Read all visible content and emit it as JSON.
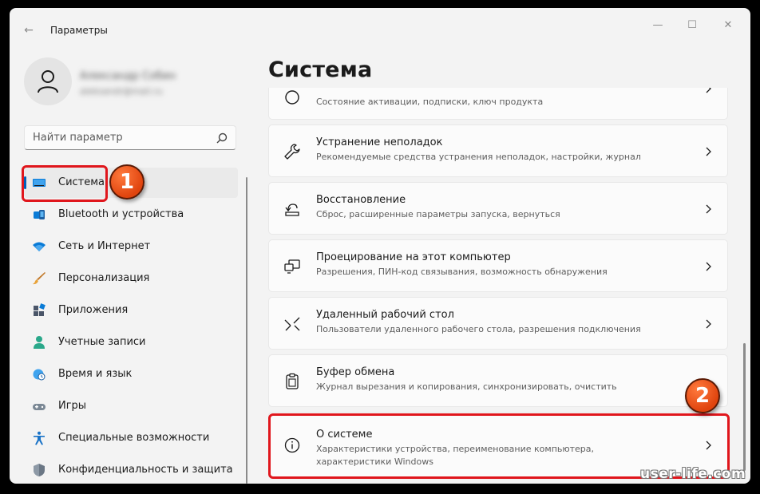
{
  "window": {
    "title": "Параметры",
    "controls": {
      "back": "←",
      "minimize": "—",
      "maximize": "☐",
      "close": "✕"
    }
  },
  "profile": {
    "name": "Александр Собин",
    "email": "aleksandr@mail.ru"
  },
  "search": {
    "placeholder": "Найти параметр",
    "value": ""
  },
  "sidebar": {
    "items": [
      {
        "label": "Система",
        "icon": "monitor-icon",
        "active": true
      },
      {
        "label": "Bluetooth и устройства",
        "icon": "bluetooth-icon"
      },
      {
        "label": "Сеть и Интернет",
        "icon": "wifi-icon"
      },
      {
        "label": "Персонализация",
        "icon": "brush-icon"
      },
      {
        "label": "Приложения",
        "icon": "apps-icon"
      },
      {
        "label": "Учетные записи",
        "icon": "person-icon"
      },
      {
        "label": "Время и язык",
        "icon": "globe-clock-icon"
      },
      {
        "label": "Игры",
        "icon": "gamepad-icon"
      },
      {
        "label": "Специальные возможности",
        "icon": "accessibility-icon"
      },
      {
        "label": "Конфиденциальность и защита",
        "icon": "shield-icon"
      }
    ]
  },
  "main": {
    "title": "Система",
    "cards": [
      {
        "title": "",
        "desc": "Состояние активации, подписки, ключ продукта",
        "icon": "activation-icon"
      },
      {
        "title": "Устранение неполадок",
        "desc": "Рекомендуемые средства устранения неполадок, настройки, журнал",
        "icon": "wrench-icon"
      },
      {
        "title": "Восстановление",
        "desc": "Сброс, расширенные параметры запуска, вернуться",
        "icon": "recovery-icon"
      },
      {
        "title": "Проецирование на этот компьютер",
        "desc": "Разрешения, ПИН-код связывания, возможность обнаружения",
        "icon": "projection-icon"
      },
      {
        "title": "Удаленный рабочий стол",
        "desc": "Пользователи удаленного рабочего стола, разрешения подключения",
        "icon": "remote-desktop-icon"
      },
      {
        "title": "Буфер обмена",
        "desc": "Журнал вырезания и копирования, синхронизировать, очистить",
        "icon": "clipboard-icon"
      },
      {
        "title": "О системе",
        "desc": "Характеристики устройства, переименование компьютера, характеристики Windows",
        "icon": "info-icon"
      }
    ]
  },
  "annotations": {
    "badge1": "1",
    "badge2": "2",
    "highlight_color": "#e0161c",
    "badge_color": "#e8521a"
  },
  "watermark": "user-life.com",
  "colors": {
    "accent": "#005fb8",
    "background": "#f3f3f3",
    "card": "#fbfbfb"
  }
}
